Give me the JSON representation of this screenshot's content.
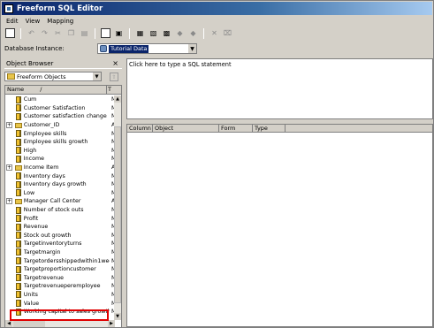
{
  "window": {
    "title": "Freeform SQL Editor"
  },
  "menu": [
    "Edit",
    "View",
    "Mapping"
  ],
  "toolbar": {
    "buttons": [
      "run-sql-icon",
      "undo-icon",
      "redo-icon",
      "cut-icon",
      "copy-icon",
      "paste-icon",
      "check-icon",
      "new-object-icon",
      "import-icon",
      "export-icon",
      "left-arrow-icon",
      "right-arrow-icon",
      "delete-icon",
      "clear-icon"
    ]
  },
  "database_instance": {
    "label": "Database Instance:",
    "value": "Tutorial Data"
  },
  "object_browser": {
    "title": "Object Browser",
    "close": "×",
    "folder": "Freeform Objects",
    "columns": {
      "name": "Name",
      "sort_marker": "/",
      "type": "T"
    },
    "items": [
      {
        "name": "Cum",
        "type": "M",
        "kind": "metric",
        "expandable": false
      },
      {
        "name": "Customer Satisfaction",
        "type": "M",
        "kind": "metric",
        "expandable": false
      },
      {
        "name": "Customer satisfaction change",
        "type": "M",
        "kind": "metric",
        "expandable": false
      },
      {
        "name": "Customer_ID",
        "type": "At",
        "kind": "attribute",
        "expandable": true
      },
      {
        "name": "Employee skills",
        "type": "M",
        "kind": "metric",
        "expandable": false
      },
      {
        "name": "Employee skills growth",
        "type": "M",
        "kind": "metric",
        "expandable": false
      },
      {
        "name": "High",
        "type": "M",
        "kind": "metric",
        "expandable": false
      },
      {
        "name": "Income",
        "type": "M",
        "kind": "metric",
        "expandable": false
      },
      {
        "name": "Income Item",
        "type": "At",
        "kind": "attribute",
        "expandable": true
      },
      {
        "name": "Inventory days",
        "type": "M",
        "kind": "metric",
        "expandable": false
      },
      {
        "name": "Inventory days growth",
        "type": "M",
        "kind": "metric",
        "expandable": false
      },
      {
        "name": "Low",
        "type": "M",
        "kind": "metric",
        "expandable": false
      },
      {
        "name": "Manager Call Center",
        "type": "At",
        "kind": "attribute",
        "expandable": true
      },
      {
        "name": "Number of stock outs",
        "type": "M",
        "kind": "metric",
        "expandable": false
      },
      {
        "name": "Profit",
        "type": "M",
        "kind": "metric",
        "expandable": false
      },
      {
        "name": "Revenue",
        "type": "M",
        "kind": "metric",
        "expandable": false
      },
      {
        "name": "Stock out growth",
        "type": "M",
        "kind": "metric",
        "expandable": false
      },
      {
        "name": "Targetinventoryturns",
        "type": "M",
        "kind": "metric",
        "expandable": false
      },
      {
        "name": "Targetmargin",
        "type": "M",
        "kind": "metric",
        "expandable": false
      },
      {
        "name": "Targetordersshippedwithin1week",
        "type": "M",
        "kind": "metric",
        "expandable": false
      },
      {
        "name": "Targetproportioncustomer",
        "type": "M",
        "kind": "metric",
        "expandable": false
      },
      {
        "name": "Targetrevenue",
        "type": "M",
        "kind": "metric",
        "expandable": false
      },
      {
        "name": "Targetrevenueperemployee",
        "type": "M",
        "kind": "metric",
        "expandable": false
      },
      {
        "name": "Units",
        "type": "M",
        "kind": "metric",
        "expandable": false
      },
      {
        "name": "Value",
        "type": "M",
        "kind": "metric",
        "expandable": false
      },
      {
        "name": "Working capital to sales growth",
        "type": "M",
        "kind": "metric",
        "expandable": false
      }
    ]
  },
  "sql_editor": {
    "placeholder": "Click here to type a SQL statement"
  },
  "results": {
    "columns": [
      "Column",
      "Object",
      "Form",
      "Type"
    ]
  },
  "colors": {
    "title_bar": "#0a246a",
    "highlight_box": "#e00000",
    "chrome": "#d4d0c8"
  }
}
